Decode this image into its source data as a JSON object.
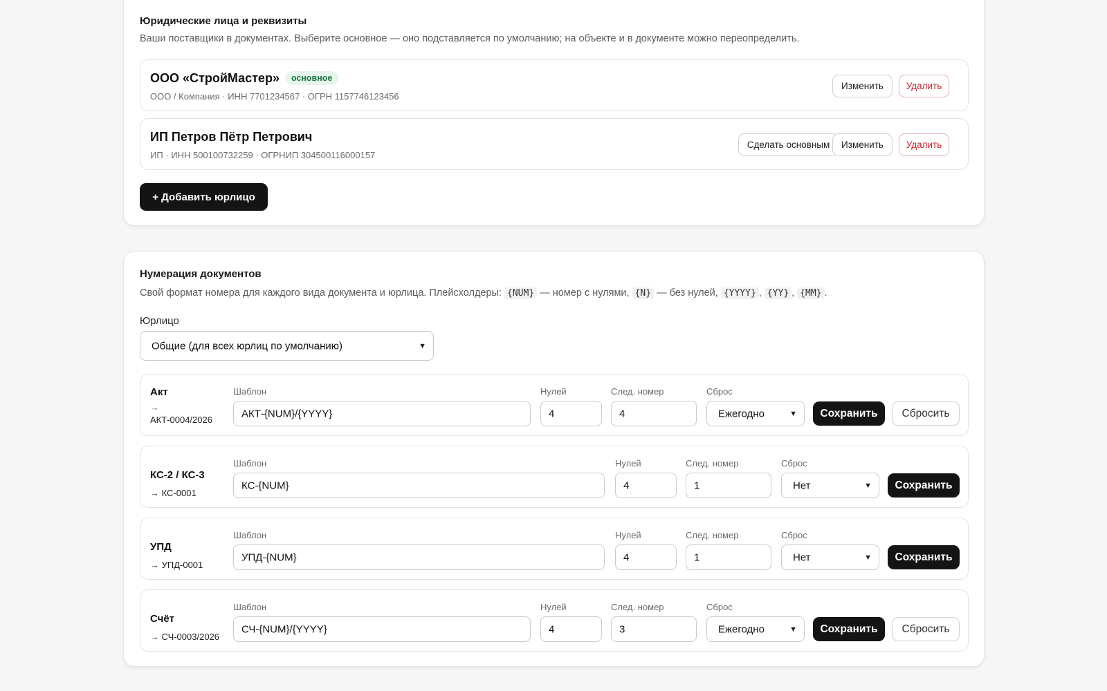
{
  "legal": {
    "title": "Юридические лица и реквизиты",
    "description": "Ваши поставщики в документах. Выберите основное — оно подставляется по умолчанию; на объекте и в документе можно переопределить.",
    "entities": [
      {
        "name": "ООО «СтройМастер»",
        "badge": "основное",
        "meta": "ООО / Компания · ИНН 7701234567 · ОГРН 1157746123456",
        "edit_label": "Изменить",
        "delete_label": "Удалить"
      },
      {
        "name": "ИП Петров Пётр Петрович",
        "meta": "ИП · ИНН 500100732259 · ОГРНИП 304500116000157",
        "make_main_label": "Сделать основным",
        "edit_label": "Изменить",
        "delete_label": "Удалить"
      }
    ],
    "add_label": "+ Добавить юрлицо"
  },
  "numbering": {
    "title": "Нумерация документов",
    "desc_parts": {
      "lead": "Свой формат номера для каждого вида документа и юрлица. Плейсхолдеры:",
      "num": "{NUM}",
      "num_text": "— номер с нулями,",
      "n": "{N}",
      "n_text": "— без нулей,",
      "yyyy": "{YYYY}",
      "yy": "{YY}",
      "mm": "{MM}",
      "comma": ",",
      "end": "."
    },
    "entity_label": "Юрлицо",
    "entity_value": "Общие (для всех юрлиц по умолчанию)",
    "labels": {
      "template": "Шаблон",
      "zeros": "Нулей",
      "next": "След. номер",
      "reset": "Сброс"
    },
    "rows": [
      {
        "title": "Акт",
        "arrow": "→",
        "preview": "АКТ-0004/2026",
        "template": "АКТ-{NUM}/{YYYY}",
        "zeros": "4",
        "next": "4",
        "reset": "Ежегодно",
        "save_label": "Сохранить",
        "reset_label": "Сбросить"
      },
      {
        "title": "КС-2 / КС-3",
        "preview": "→ КС-0001",
        "template": "КС-{NUM}",
        "zeros": "4",
        "next": "1",
        "reset": "Нет",
        "save_label": "Сохранить"
      },
      {
        "title": "УПД",
        "preview": "→ УПД-0001",
        "template": "УПД-{NUM}",
        "zeros": "4",
        "next": "1",
        "reset": "Нет",
        "save_label": "Сохранить"
      },
      {
        "title": "Счёт",
        "preview": "→ СЧ-0003/2026",
        "template": "СЧ-{NUM}/{YYYY}",
        "zeros": "4",
        "next": "3",
        "reset": "Ежегодно",
        "save_label": "Сохранить",
        "reset_label": "Сбросить"
      }
    ]
  }
}
